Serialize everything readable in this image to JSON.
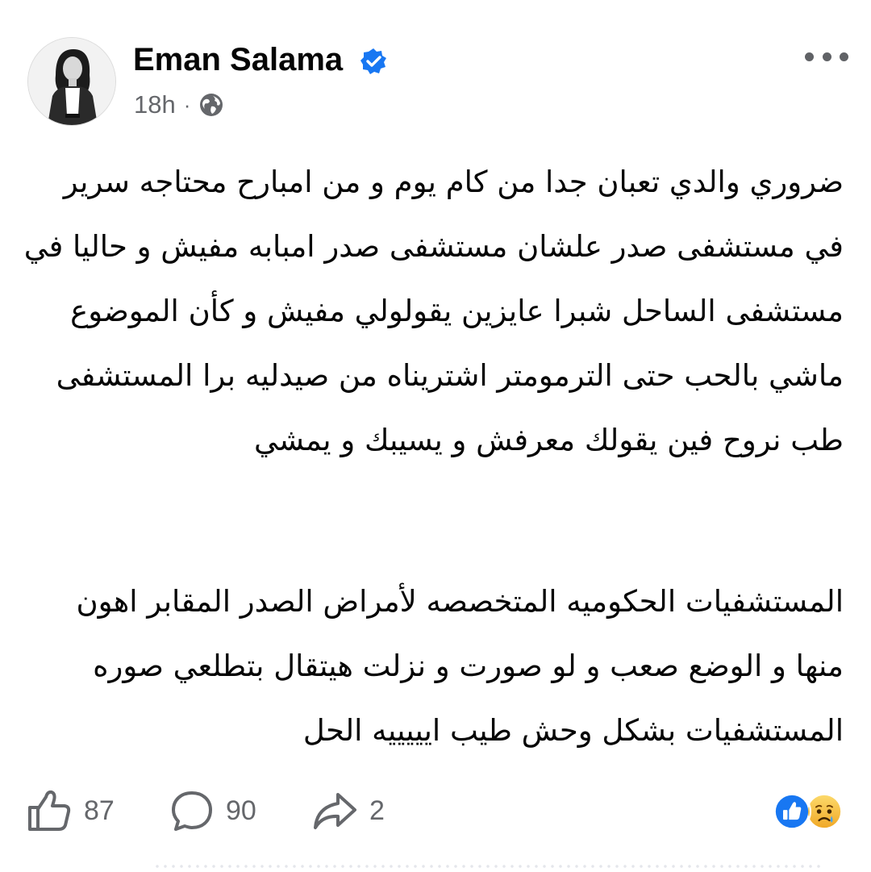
{
  "post": {
    "author": "Eman Salama",
    "time": "18h",
    "separator": "·",
    "privacy_icon": "globe-icon",
    "verified_icon": "verified-badge-icon",
    "menu_icon": "more-options-icon",
    "body_paragraph_1": [
      "ضروري والدي تعبان جدا من كام يوم و من امبارح محتاجه سرير",
      "في مستشفى صدر علشان مستشفى صدر امبابه مفيش و حاليا في",
      "مستشفى الساحل شبرا  عايزين يقولولي مفيش و كأن الموضوع",
      "ماشي بالحب حتى الترمومتر اشتريناه من صيدليه برا المستشفى",
      "طب نروح فين يقولك معرفش و يسيبك و يمشي"
    ],
    "body_paragraph_2": [
      "المستشفيات الحكوميه المتخصصه لأمراض الصدر المقابر اهون",
      "منها و الوضع صعب و لو صورت و نزلت هيتقال بتطلعي صوره",
      "المستشفيات بشكل وحش طيب ايييييه الحل"
    ]
  },
  "footer": {
    "likes": "87",
    "comments": "90",
    "shares": "2",
    "like_icon": "thumbs-up-icon",
    "comment_icon": "comment-bubble-icon",
    "share_icon": "share-arrow-icon",
    "reactions": [
      "like-reaction-icon",
      "sad-reaction-icon"
    ]
  },
  "colors": {
    "text": "#050505",
    "secondary": "#65676b",
    "verified_blue": "#1877f2",
    "sad_yellow": "#f7c948"
  }
}
